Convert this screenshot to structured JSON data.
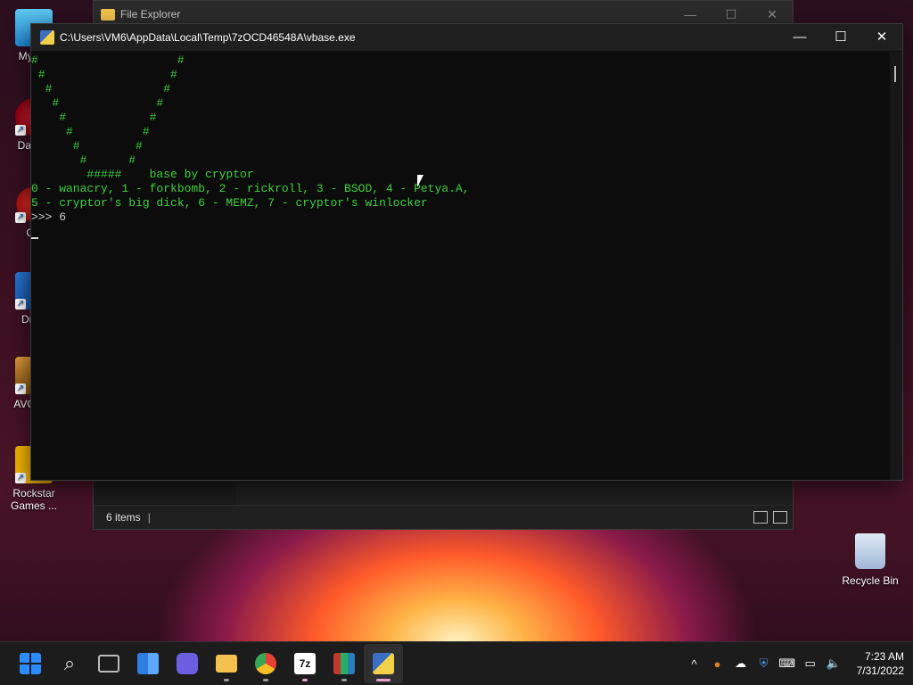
{
  "desktop": {
    "icons": [
      {
        "label": "My Co"
      },
      {
        "label": "DataW"
      },
      {
        "label": "CC"
      },
      {
        "label": "Drive"
      },
      {
        "label": "AVG A F"
      },
      {
        "label": "Rockstar Games ..."
      }
    ],
    "recycle_bin": "Recycle Bin"
  },
  "explorer": {
    "title": "File Explorer",
    "status": "6 items"
  },
  "console": {
    "title": "C:\\Users\\VM6\\AppData\\Local\\Temp\\7zOCD46548A\\vbase.exe",
    "lines": [
      "#                    #",
      " #                  #",
      "  #                #",
      "   #              #",
      "    #            #",
      "     #          #",
      "      #        #",
      "       #      #",
      "        #####    base by cryptor",
      "0 - wanacry, 1 - forkbomb, 2 - rickroll, 3 - BSOD, 4 - Petya.A,",
      "5 - cryptor's big dick, 6 - MEMZ, 7 - cryptor's winlocker"
    ],
    "prompt": ">>> 6"
  },
  "window_controls": {
    "minimize": "—",
    "maximize": "☐",
    "close": "✕"
  },
  "taskbar": {
    "apps": [
      {
        "name": "start",
        "color": "#2b8cff"
      },
      {
        "name": "search",
        "color": "#dddddd"
      },
      {
        "name": "task-view",
        "color": "#bbbbbb"
      },
      {
        "name": "widgets",
        "color": "#2f7de1"
      },
      {
        "name": "teams-chat",
        "color": "#6b5fe0"
      },
      {
        "name": "file-explorer",
        "color": "#f2c14e"
      },
      {
        "name": "chrome",
        "color": "#e44134"
      },
      {
        "name": "7zip",
        "color": "#2b2b2b"
      },
      {
        "name": "winrar",
        "color": "#c0392b"
      },
      {
        "name": "vbase",
        "color": "#3b6fc4"
      }
    ],
    "time": "7:23 AM",
    "date": "7/31/2022"
  }
}
